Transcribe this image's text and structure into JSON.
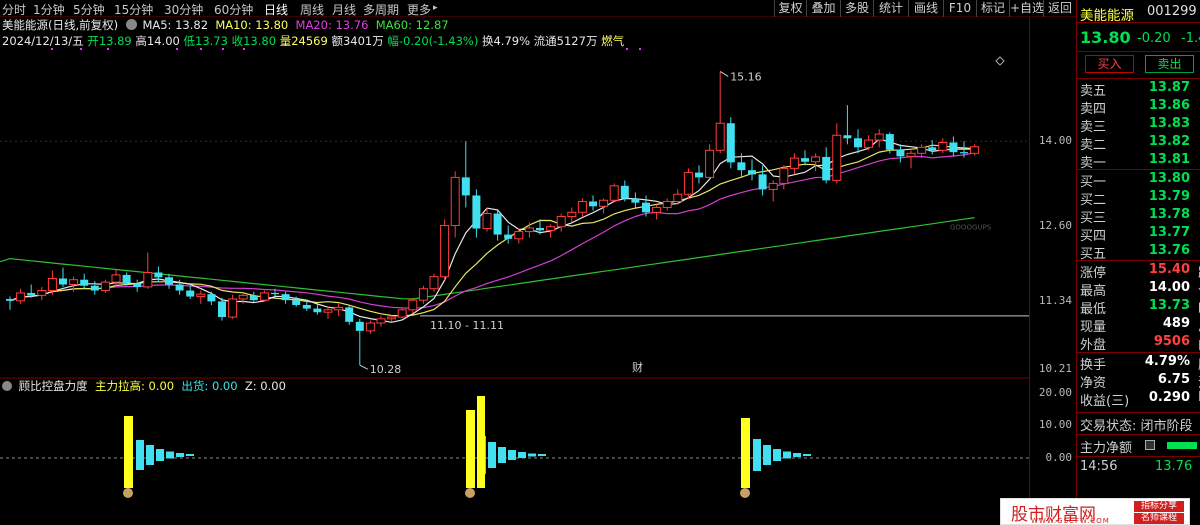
{
  "toolbar": {
    "periods": [
      "分时",
      "1分钟",
      "5分钟",
      "15分钟",
      "30分钟",
      "60分钟",
      "日线",
      "周线",
      "月线",
      "多周期",
      "更多"
    ],
    "active_period": "日线",
    "more_arrow": "▸",
    "buttons": [
      "复权",
      "叠加",
      "多股",
      "统计",
      "画线",
      "F10",
      "标记",
      "+自选",
      "返回"
    ]
  },
  "header": {
    "stock_title": "美能能源(日线,前复权)",
    "ma5": "MA5: 13.82",
    "ma10": "MA10: 13.80",
    "ma20": "MA20: 13.76",
    "ma60": "MA60: 12.87",
    "date": "2024/12/13/五",
    "open": "开13.89",
    "high": "高14.00",
    "low": "低13.73",
    "close": "收13.80",
    "volume": "量24569",
    "amount": "额3401万",
    "change": "幅-0.20(-1.43%)",
    "turnover": "换4.79%",
    "float": "流通5127万",
    "concept": "燃气"
  },
  "chart_data": {
    "type": "candlestick",
    "price_ticks": [
      "14.00",
      "12.60",
      "11.34",
      "10.21"
    ],
    "indicator_ticks": [
      "20.00",
      "10.00",
      "0.00"
    ],
    "annotations": [
      "15.16",
      "10.28",
      "11.10 - 11.11",
      "财",
      "GOOOGUPS"
    ],
    "ohlc": [
      [
        11.38,
        11.42,
        11.2,
        11.35
      ],
      [
        11.35,
        11.55,
        11.3,
        11.48
      ],
      [
        11.48,
        11.62,
        11.4,
        11.44
      ],
      [
        11.44,
        11.58,
        11.36,
        11.52
      ],
      [
        11.52,
        11.85,
        11.45,
        11.72
      ],
      [
        11.72,
        11.9,
        11.58,
        11.62
      ],
      [
        11.62,
        11.75,
        11.5,
        11.7
      ],
      [
        11.7,
        11.8,
        11.55,
        11.6
      ],
      [
        11.6,
        11.68,
        11.45,
        11.52
      ],
      [
        11.52,
        11.7,
        11.48,
        11.66
      ],
      [
        11.66,
        11.86,
        11.6,
        11.78
      ],
      [
        11.78,
        11.82,
        11.6,
        11.64
      ],
      [
        11.64,
        11.7,
        11.5,
        11.58
      ],
      [
        11.58,
        12.15,
        11.55,
        11.82
      ],
      [
        11.82,
        11.92,
        11.66,
        11.74
      ],
      [
        11.74,
        11.8,
        11.55,
        11.62
      ],
      [
        11.62,
        11.7,
        11.45,
        11.52
      ],
      [
        11.52,
        11.6,
        11.38,
        11.42
      ],
      [
        11.42,
        11.52,
        11.3,
        11.46
      ],
      [
        11.46,
        11.5,
        11.28,
        11.34
      ],
      [
        11.34,
        11.4,
        11.02,
        11.08
      ],
      [
        11.08,
        11.45,
        11.05,
        11.38
      ],
      [
        11.38,
        11.48,
        11.3,
        11.44
      ],
      [
        11.44,
        11.5,
        11.32,
        11.36
      ],
      [
        11.36,
        11.52,
        11.34,
        11.48
      ],
      [
        11.48,
        11.55,
        11.4,
        11.46
      ],
      [
        11.46,
        11.5,
        11.3,
        11.36
      ],
      [
        11.36,
        11.42,
        11.25,
        11.28
      ],
      [
        11.28,
        11.35,
        11.18,
        11.22
      ],
      [
        11.22,
        11.3,
        11.12,
        11.16
      ],
      [
        11.16,
        11.26,
        11.05,
        11.2
      ],
      [
        11.2,
        11.3,
        11.1,
        11.24
      ],
      [
        11.24,
        11.28,
        10.95,
        11.0
      ],
      [
        11.0,
        11.05,
        10.28,
        10.85
      ],
      [
        10.85,
        11.02,
        10.8,
        10.98
      ],
      [
        10.98,
        11.1,
        10.92,
        11.05
      ],
      [
        11.05,
        11.11,
        11.0,
        11.08
      ],
      [
        11.08,
        11.24,
        11.06,
        11.2
      ],
      [
        11.2,
        11.4,
        11.15,
        11.36
      ],
      [
        11.36,
        11.6,
        11.3,
        11.55
      ],
      [
        11.55,
        11.8,
        11.5,
        11.75
      ],
      [
        11.75,
        12.7,
        11.7,
        12.6
      ],
      [
        12.6,
        13.5,
        12.4,
        13.4
      ],
      [
        13.4,
        14.0,
        12.9,
        13.1
      ],
      [
        13.1,
        13.2,
        12.4,
        12.55
      ],
      [
        12.55,
        12.9,
        12.5,
        12.8
      ],
      [
        12.8,
        12.85,
        12.35,
        12.45
      ],
      [
        12.45,
        12.6,
        12.3,
        12.38
      ],
      [
        12.38,
        12.55,
        12.3,
        12.5
      ],
      [
        12.5,
        12.65,
        12.4,
        12.56
      ],
      [
        12.56,
        12.7,
        12.45,
        12.52
      ],
      [
        12.52,
        12.62,
        12.4,
        12.58
      ],
      [
        12.58,
        12.8,
        12.5,
        12.75
      ],
      [
        12.75,
        12.9,
        12.65,
        12.82
      ],
      [
        12.82,
        13.05,
        12.75,
        13.0
      ],
      [
        13.0,
        13.1,
        12.85,
        12.92
      ],
      [
        12.92,
        13.05,
        12.8,
        13.02
      ],
      [
        13.02,
        13.3,
        12.98,
        13.26
      ],
      [
        13.26,
        13.35,
        13.0,
        13.05
      ],
      [
        13.05,
        13.15,
        12.9,
        12.98
      ],
      [
        12.98,
        13.1,
        12.75,
        12.82
      ],
      [
        12.82,
        12.95,
        12.7,
        12.9
      ],
      [
        12.9,
        13.05,
        12.85,
        13.0
      ],
      [
        13.0,
        13.2,
        12.95,
        13.12
      ],
      [
        13.12,
        13.55,
        13.05,
        13.48
      ],
      [
        13.48,
        13.6,
        13.3,
        13.4
      ],
      [
        13.4,
        13.95,
        13.38,
        13.85
      ],
      [
        13.85,
        15.16,
        13.8,
        14.3
      ],
      [
        14.3,
        14.4,
        13.55,
        13.65
      ],
      [
        13.65,
        13.8,
        13.4,
        13.52
      ],
      [
        13.52,
        13.7,
        13.35,
        13.45
      ],
      [
        13.45,
        13.6,
        13.1,
        13.2
      ],
      [
        13.2,
        13.35,
        13.0,
        13.3
      ],
      [
        13.3,
        13.6,
        13.2,
        13.55
      ],
      [
        13.55,
        13.8,
        13.45,
        13.72
      ],
      [
        13.72,
        13.85,
        13.6,
        13.66
      ],
      [
        13.66,
        13.8,
        13.5,
        13.74
      ],
      [
        13.74,
        13.9,
        13.3,
        13.35
      ],
      [
        13.35,
        14.3,
        13.3,
        14.1
      ],
      [
        14.1,
        14.6,
        13.95,
        14.05
      ],
      [
        14.05,
        14.2,
        13.8,
        13.9
      ],
      [
        13.9,
        14.1,
        13.85,
        14.02
      ],
      [
        14.02,
        14.2,
        13.9,
        14.12
      ],
      [
        14.12,
        14.15,
        13.8,
        13.86
      ],
      [
        13.86,
        13.95,
        13.65,
        13.75
      ],
      [
        13.75,
        13.85,
        13.55,
        13.8
      ],
      [
        13.8,
        13.95,
        13.72,
        13.9
      ],
      [
        13.9,
        14.02,
        13.78,
        13.85
      ],
      [
        13.85,
        14.05,
        13.8,
        13.98
      ],
      [
        13.98,
        14.08,
        13.75,
        13.82
      ],
      [
        13.82,
        14.0,
        13.73,
        13.8
      ],
      [
        13.8,
        13.95,
        13.76,
        13.91
      ]
    ]
  },
  "indicator": {
    "name": "顾比控盘力度",
    "main_label": "主力拉高: 0.00",
    "out_label": "出货: 0.00",
    "z_label": "Z: 0.00"
  },
  "quote": {
    "name": "美能能源",
    "code": "001299",
    "price": "13.80",
    "change": "-0.20",
    "change_pct": "-1.4",
    "buy_btn": "买入",
    "sell_btn": "卖出",
    "asks": [
      {
        "label": "卖五",
        "price": "13.87"
      },
      {
        "label": "卖四",
        "price": "13.86"
      },
      {
        "label": "卖三",
        "price": "13.83"
      },
      {
        "label": "卖二",
        "price": "13.82"
      },
      {
        "label": "卖一",
        "price": "13.81"
      }
    ],
    "bids": [
      {
        "label": "买一",
        "price": "13.80"
      },
      {
        "label": "买二",
        "price": "13.79"
      },
      {
        "label": "买三",
        "price": "13.78"
      },
      {
        "label": "买四",
        "price": "13.77"
      },
      {
        "label": "买五",
        "price": "13.76"
      }
    ],
    "stats": [
      {
        "label": "涨停",
        "value": "15.40",
        "cut": "跌",
        "color": "#ff4040"
      },
      {
        "label": "最高",
        "value": "14.00",
        "cut": "今",
        "color": "#ffffff"
      },
      {
        "label": "最低",
        "value": "13.73",
        "cut": "昨",
        "color": "#00e050"
      },
      {
        "label": "现量",
        "value": "489",
        "cut": "总",
        "color": "#ffffff"
      },
      {
        "label": "外盘",
        "value": "9506",
        "cut": "内",
        "color": "#ff4040"
      }
    ],
    "stats2": [
      {
        "label": "换手",
        "value": "4.79%",
        "cut": "股",
        "color": "#ffffff"
      },
      {
        "label": "净资",
        "value": "6.75",
        "cut": "流",
        "color": "#ffffff"
      },
      {
        "label": "收益(三)",
        "value": "0.290",
        "cut": "P",
        "color": "#ffffff"
      }
    ],
    "trade_status": "交易状态: 闭市阶段",
    "net_label": "主力净额",
    "last_time": "14:56",
    "last_price": "13.76"
  },
  "watermark": {
    "title": "股市财富网",
    "tag1": "指标分享",
    "tag2": "名师课程",
    "url": "WWW.GSCFW.COM"
  }
}
